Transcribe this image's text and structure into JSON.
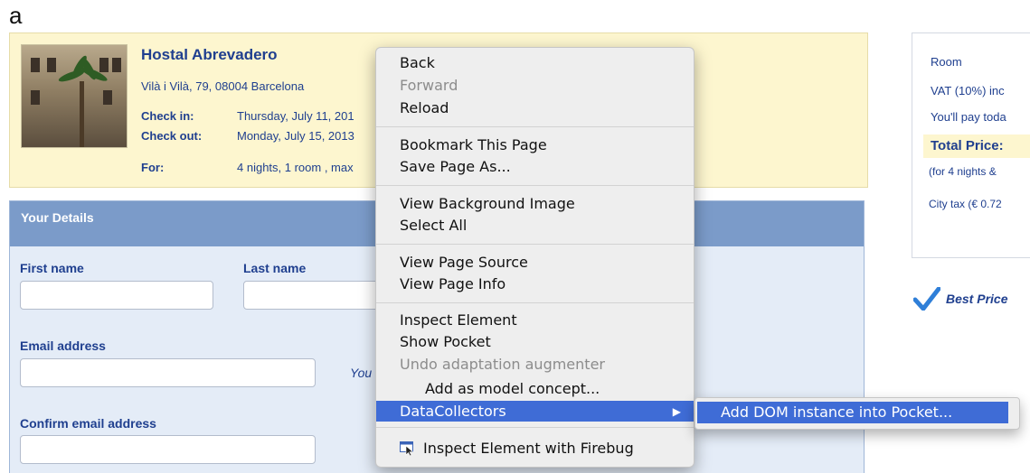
{
  "figure_label": "a",
  "hotel": {
    "name": "Hostal Abrevadero",
    "address": "Vilà i Vilà, 79, 08004 Barcelona",
    "check_in_label": "Check in:",
    "check_in_value": "Thursday, July 11, 201",
    "check_out_label": "Check out:",
    "check_out_value": "Monday, July 15, 2013",
    "for_label": "For:",
    "for_value": "4 nights, 1 room , max"
  },
  "details": {
    "header": "Your Details",
    "first_name_label": "First name",
    "last_name_label": "Last name",
    "email_label": "Email address",
    "email_note": "You",
    "confirm_email_label": "Confirm email address"
  },
  "price_panel": {
    "room_label": "Room",
    "vat_label": "VAT (10%) inc",
    "pay_today_label": "You'll pay toda",
    "total_label": "Total Price:",
    "nights_note": "(for 4 nights &",
    "city_tax": "City tax (€ 0.72",
    "best_price": "Best Price"
  },
  "context_menu": {
    "items": [
      {
        "label": "Back",
        "disabled": false
      },
      {
        "label": "Forward",
        "disabled": true
      },
      {
        "label": "Reload",
        "disabled": false
      },
      {
        "label": "Bookmark This Page",
        "disabled": false
      },
      {
        "label": "Save Page As...",
        "disabled": false
      },
      {
        "label": "View Background Image",
        "disabled": false
      },
      {
        "label": "Select All",
        "disabled": false
      },
      {
        "label": "View Page Source",
        "disabled": false
      },
      {
        "label": "View Page Info",
        "disabled": false
      },
      {
        "label": "Inspect Element",
        "disabled": false
      },
      {
        "label": "Show Pocket",
        "disabled": false
      },
      {
        "label": "Undo adaptation augmenter",
        "disabled": true
      },
      {
        "label": "Add as model concept...",
        "disabled": false
      },
      {
        "label": "DataCollectors",
        "disabled": false,
        "highlighted": true,
        "submenu": true
      },
      {
        "label": "Inspect Element with Firebug",
        "disabled": false,
        "icon": "firebug-icon"
      }
    ],
    "submenu_item": "Add DOM instance into Pocket..."
  },
  "colors": {
    "menu_highlight": "#3f6cd6",
    "hotel_box_bg": "#fdf6cf",
    "details_header_bg": "#7b9bc9",
    "link_blue": "#1f3f8f",
    "check_mark": "#2f7fd8"
  }
}
